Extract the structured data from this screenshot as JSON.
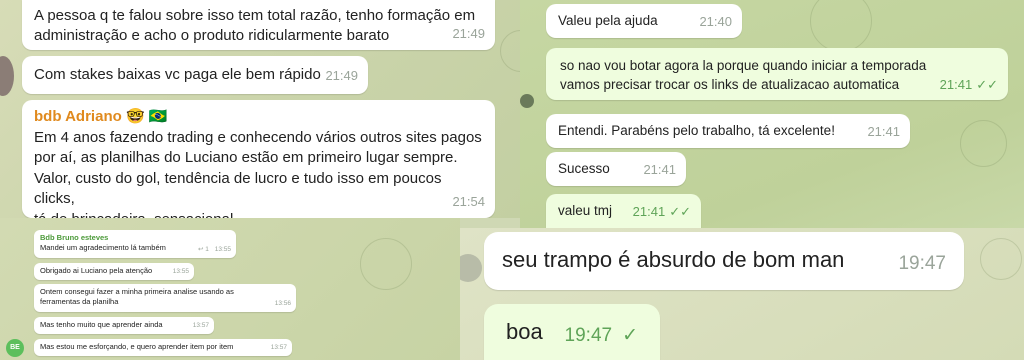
{
  "panel1": {
    "messages": [
      {
        "text": "A pessoa q te falou sobre isso tem total razão, tenho formação em\nadministração e acho o produto ridicularmente barato",
        "time": "21:49"
      },
      {
        "text": "Com stakes baixas vc paga ele bem rápido",
        "time": "21:49"
      },
      {
        "sender": "bdb Adriano",
        "sender_emoji": "🤓",
        "flag": "🇧🇷",
        "text": "Em 4 anos fazendo trading e conhecendo vários outros sites pagos\npor aí, as planilhas do Luciano estão em primeiro lugar sempre.\nValor, custo do gol, tendência de lucro e tudo isso em poucos clicks,\ntá de brincadeira, sensacional",
        "time": "21:54"
      }
    ]
  },
  "panel2": {
    "messages": [
      {
        "text": "Valeu pela ajuda",
        "time": "21:40"
      },
      {
        "text": "so nao vou botar agora la porque quando iniciar a temporada\nvamos precisar trocar os links de atualizacao automatica",
        "time": "21:41",
        "check": "✓✓"
      },
      {
        "text": "Entendi. Parabéns pelo trabalho, tá excelente!",
        "time": "21:41"
      },
      {
        "text": "Sucesso",
        "time": "21:41"
      },
      {
        "text": "valeu tmj",
        "time": "21:41",
        "check": "✓✓"
      }
    ]
  },
  "panel3": {
    "sender": "Bdb Bruno esteves",
    "avatar_initials": "BE",
    "messages": [
      {
        "text": "Mandei um agradecimento lá também",
        "reply_icon": "↩",
        "reply_count": "1",
        "time": "13:55"
      },
      {
        "text": "Obrigado ai Luciano pela atenção",
        "time": "13:55"
      },
      {
        "text": "Ontem consegui fazer a minha primeira analise usando as\nferramentas da planilha",
        "time": "13:56"
      },
      {
        "text": "Mas tenho muito que aprender ainda",
        "time": "13:57"
      },
      {
        "text": "Mas estou me esforçando, e quero aprender item por item",
        "time": "13:57"
      }
    ]
  },
  "panel4": {
    "messages": [
      {
        "text": "seu trampo é absurdo de bom man",
        "time": "19:47"
      },
      {
        "text": "boa",
        "time": "19:47",
        "check": "✓"
      }
    ]
  },
  "colors": {
    "sender_orange": "#e08a1e",
    "sender_green": "#4c9a3a",
    "check_green": "#5fa458"
  }
}
